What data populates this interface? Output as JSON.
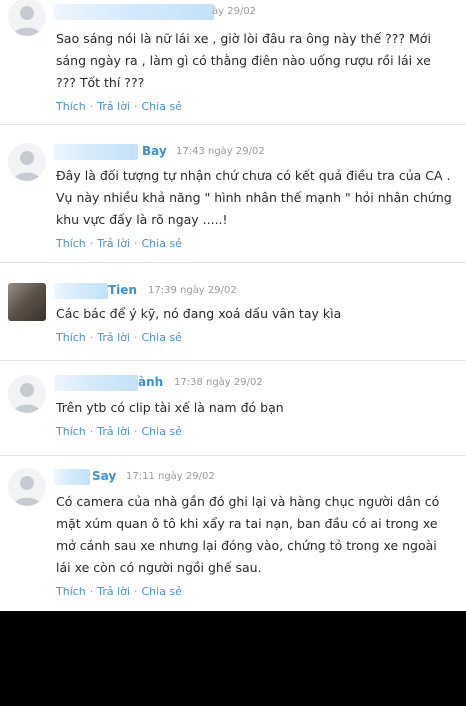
{
  "actions": {
    "like": "Thích",
    "reply": "Trả lời",
    "share": "Chia sẻ",
    "separator": "·"
  },
  "comments": [
    {
      "name": "",
      "time": "ày 29/02",
      "lines": [
        "Sao sáng nói là nữ lái xe , giờ lòi đâu ra ông này thế ??? Mới",
        "sáng ngày ra , làm gì có thằng điên nào uống rượu rồi lái xe",
        "??? Tốt thí ???"
      ]
    },
    {
      "name": "Bay",
      "time": "17:43 ngày 29/02",
      "lines": [
        "Đây là đối tượng tự nhận chứ chưa có kết quả điều tra của CA .",
        "Vụ này nhiều khả năng \" hình nhân thế mạnh \" hỏi nhân chứng",
        "khu vực đấy là rõ ngay .....!"
      ]
    },
    {
      "name": "Tien",
      "time": "17:39 ngày 29/02",
      "lines": [
        "Các bác để ý kỹ, nó đang xoá dấu vân tay kìa"
      ]
    },
    {
      "name": "ành",
      "time": "17:38 ngày 29/02",
      "lines": [
        "Trên ytb có clip tài xế là nam đó bạn"
      ]
    },
    {
      "name": "Say",
      "time": "17:11 ngày 29/02",
      "lines": [
        "Có camera của nhà gần đó ghi lại và hàng chục người dân có",
        "mặt xúm quan ô tô khi xẩy ra tai nạn, ban đầu có ai trong xe",
        "mở cánh sau xe nhưng lại đóng vào, chứng tỏ trong xe ngoài",
        "lái xe còn có người ngồi ghế sau."
      ]
    }
  ]
}
